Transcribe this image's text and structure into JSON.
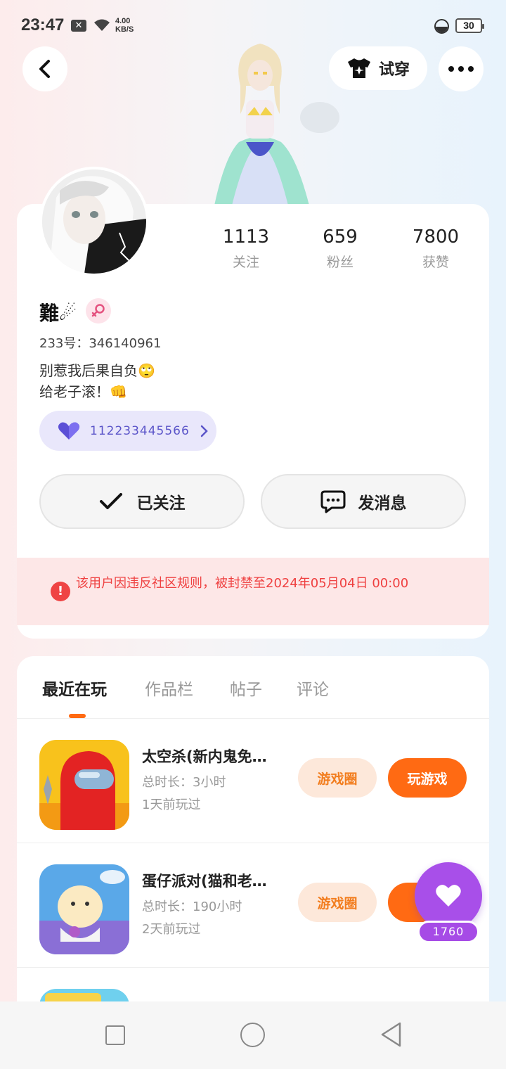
{
  "status_bar": {
    "time": "23:47",
    "speed_value": "4.00",
    "speed_unit": "KB/S",
    "battery": "30"
  },
  "header": {
    "tryon_label": "试穿"
  },
  "profile": {
    "name": "難☄",
    "uid": "233号：346140961",
    "bio_line1": "别惹我后果自负🙄",
    "bio_line2": "给老子滚！👊",
    "guild_id": "112233445566",
    "stats": [
      {
        "value": "1113",
        "label": "关注"
      },
      {
        "value": "659",
        "label": "粉丝"
      },
      {
        "value": "7800",
        "label": "获赞"
      }
    ],
    "follow_label": "已关注",
    "message_label": "发消息",
    "ban_notice": "该用户因违反社区规则，被封禁至2024年05月04日 00:00"
  },
  "tabs": [
    "最近在玩",
    "作品栏",
    "帖子",
    "评论"
  ],
  "games": [
    {
      "title": "太空杀(新内鬼免…",
      "duration": "总时长：3小时",
      "last_played": "1天前玩过",
      "circle_label": "游戏圈",
      "play_label": "玩游戏"
    },
    {
      "title": "蛋仔派对(猫和老…",
      "duration": "总时长：190小时",
      "last_played": "2天前玩过",
      "circle_label": "游戏圈",
      "play_label": "玩"
    }
  ],
  "floating_like": {
    "count": "1760"
  },
  "colors": {
    "accent": "#ff6a13",
    "like": "#a84fe9",
    "ban_text": "#ef4040",
    "guild": "#5b55c9"
  }
}
